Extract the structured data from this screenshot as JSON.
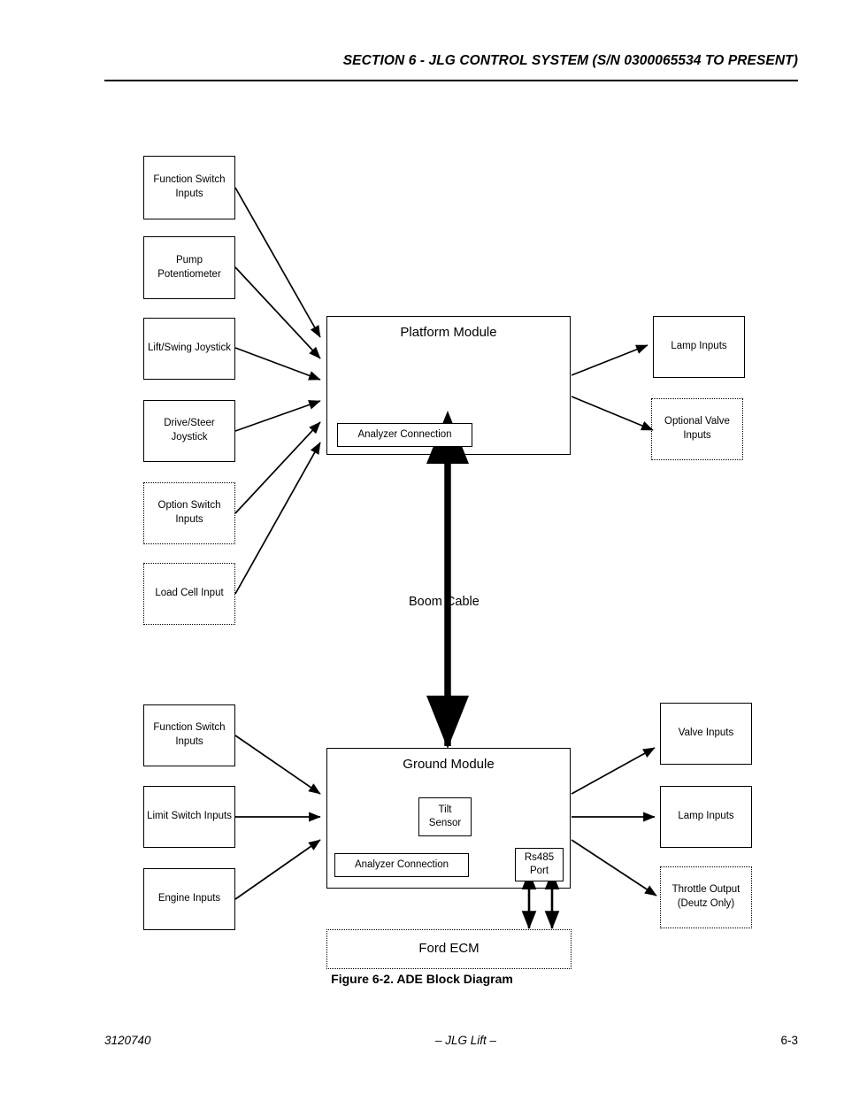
{
  "header": {
    "title": "SECTION 6 - JLG CONTROL SYSTEM (S/N 0300065534 TO PRESENT)"
  },
  "diagram": {
    "platform_inputs": [
      {
        "label": "Function Switch\nInputs",
        "style": "solid"
      },
      {
        "label": "Pump\nPotentiometer",
        "style": "solid"
      },
      {
        "label": "Lift/Swing Joystick",
        "style": "solid"
      },
      {
        "label": "Drive/Steer Joystick",
        "style": "solid"
      },
      {
        "label": "Option Switch\nInputs",
        "style": "dotted"
      },
      {
        "label": "Load Cell Input",
        "style": "dotted"
      }
    ],
    "platform_module": {
      "title": "Platform Module",
      "analyzer_connection": "Analyzer Connection"
    },
    "platform_outputs": [
      {
        "label": "Lamp Inputs",
        "style": "solid"
      },
      {
        "label": "Optional Valve\nInputs",
        "style": "dotted"
      }
    ],
    "boom_cable": "Boom Cable",
    "ground_inputs": [
      {
        "label": "Function Switch\nInputs",
        "style": "solid"
      },
      {
        "label": "Limit Switch Inputs",
        "style": "solid"
      },
      {
        "label": "Engine Inputs",
        "style": "solid"
      }
    ],
    "ground_module": {
      "title": "Ground Module",
      "tilt_sensor": "Tilt\nSensor",
      "analyzer_connection": "Analyzer Connection",
      "rs485_port": "Rs485\nPort"
    },
    "ground_outputs": [
      {
        "label": "Valve Inputs",
        "style": "solid"
      },
      {
        "label": "Lamp Inputs",
        "style": "solid"
      },
      {
        "label": "Throttle Output\n(Deutz Only)",
        "style": "dotted"
      }
    ],
    "ford_ecm": {
      "label": "Ford ECM",
      "style": "dotted"
    }
  },
  "caption": "Figure 6-2.  ADE Block Diagram",
  "footer": {
    "left": "3120740",
    "center": "– JLG Lift –",
    "right": "6-3"
  },
  "colors": {
    "ink": "#000000",
    "page": "#ffffff"
  }
}
